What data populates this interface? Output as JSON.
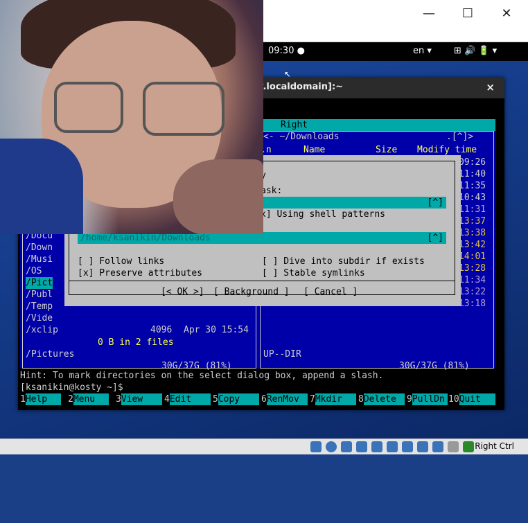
{
  "gnome_bar": {
    "time": "09:30 ●",
    "lang": "en ▾",
    "icons": "⊞ 🔊 🔋 ▾"
  },
  "window_controls": {
    "minimize": "—",
    "maximize": "☐",
    "close": "✕"
  },
  "terminal": {
    "title": "ty.localdomain]:~",
    "close": "×"
  },
  "mc": {
    "menu_right": "Right",
    "left_panel": {
      "entries": [
        "/Docu",
        "/Down",
        "/Musi",
        "/OS",
        "/Pict",
        "/Publ",
        "/Temp",
        "/Vide",
        "/xclip"
      ],
      "selected_index": 4,
      "xclip_size": "4096",
      "xclip_time": "Apr 30 15:54",
      "summary": "0 B in 2 files",
      "current": "/Pictures",
      "disk": "30G/37G (81%)"
    },
    "right_panel": {
      "title": "<- ~/Downloads",
      "title_marks": ".[^]>",
      "col_n": ".n",
      "col_name": "Name",
      "col_size": "Size",
      "col_modify": "Modify time",
      "times": [
        "09:26",
        "11:40",
        "11:35",
        "10:43",
        "11:31",
        "13:37",
        "13:38",
        "13:42",
        "14:01",
        "13:28",
        "11:34",
        "13:22",
        "13:18"
      ],
      "current": "UP--DIR",
      "disk": "30G/37G (81%)"
    }
  },
  "dialog": {
    "title_fragment": "y",
    "mask_label": "ask:",
    "mask_history": "[^]",
    "shell_patterns": "x] Using shell patterns",
    "target_history": "[^]",
    "target_value": "/home/ksanikin/Downloads",
    "follow_links": "[ ] Follow links",
    "preserve_attrs": "[x] Preserve attributes",
    "dive_subdir": "[ ] Dive into subdir if exists",
    "stable_symlinks": "[ ] Stable symlinks",
    "ok_button": "[< OK >]",
    "background_button": "[ Background ]",
    "cancel_button": "[ Cancel ]"
  },
  "hint": "Hint: To mark directories on the select dialog box, append a slash.",
  "prompt": "[ksanikin@kosty ~]$",
  "fkeys": [
    {
      "n": "1",
      "label": "Help"
    },
    {
      "n": "2",
      "label": "Menu"
    },
    {
      "n": "3",
      "label": "View"
    },
    {
      "n": "4",
      "label": "Edit"
    },
    {
      "n": "5",
      "label": "Copy"
    },
    {
      "n": "6",
      "label": "RenMov"
    },
    {
      "n": "7",
      "label": "Mkdir"
    },
    {
      "n": "8",
      "label": "Delete"
    },
    {
      "n": "9",
      "label": "PullDn"
    },
    {
      "n": "10",
      "label": "Quit"
    }
  ],
  "vbox_status": {
    "host_key": "Right Ctrl"
  }
}
